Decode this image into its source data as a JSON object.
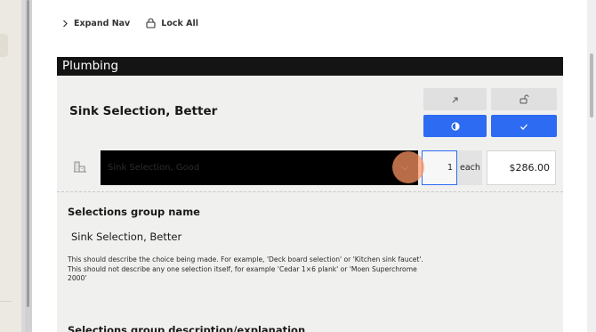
{
  "nav": {
    "expand_label": "Expand Nav",
    "lock_label": "Lock All"
  },
  "section": {
    "title": "Plumbing"
  },
  "item": {
    "title": "Sink Selection, Better",
    "dropdown_value": "Sink Selection, Good",
    "quantity": "1",
    "unit": "each",
    "price": "$286.00"
  },
  "form": {
    "group_name_label": "Selections group name",
    "group_name_value": "Sink Selection, Better",
    "group_name_help": "This should describe the choice being made. For example, 'Deck board selection' or 'Kitchen sink faucet'. This should not describe any one selection itself, for example 'Cedar 1×6 plank' or 'Moen Superchrome 2000'",
    "description_label": "Selections group description/explanation"
  },
  "colors": {
    "accent": "#2d6bf2",
    "header_bg": "#141414",
    "cursor": "#ff9664"
  },
  "icons": {
    "expand": "chevron-right-icon",
    "lock": "lock-icon",
    "external": "arrow-up-right-icon",
    "unlock": "unlock-icon",
    "contrast": "half-circle-icon",
    "check": "check-icon",
    "row": "building-icon",
    "dropdown": "chevron-down-icon"
  }
}
